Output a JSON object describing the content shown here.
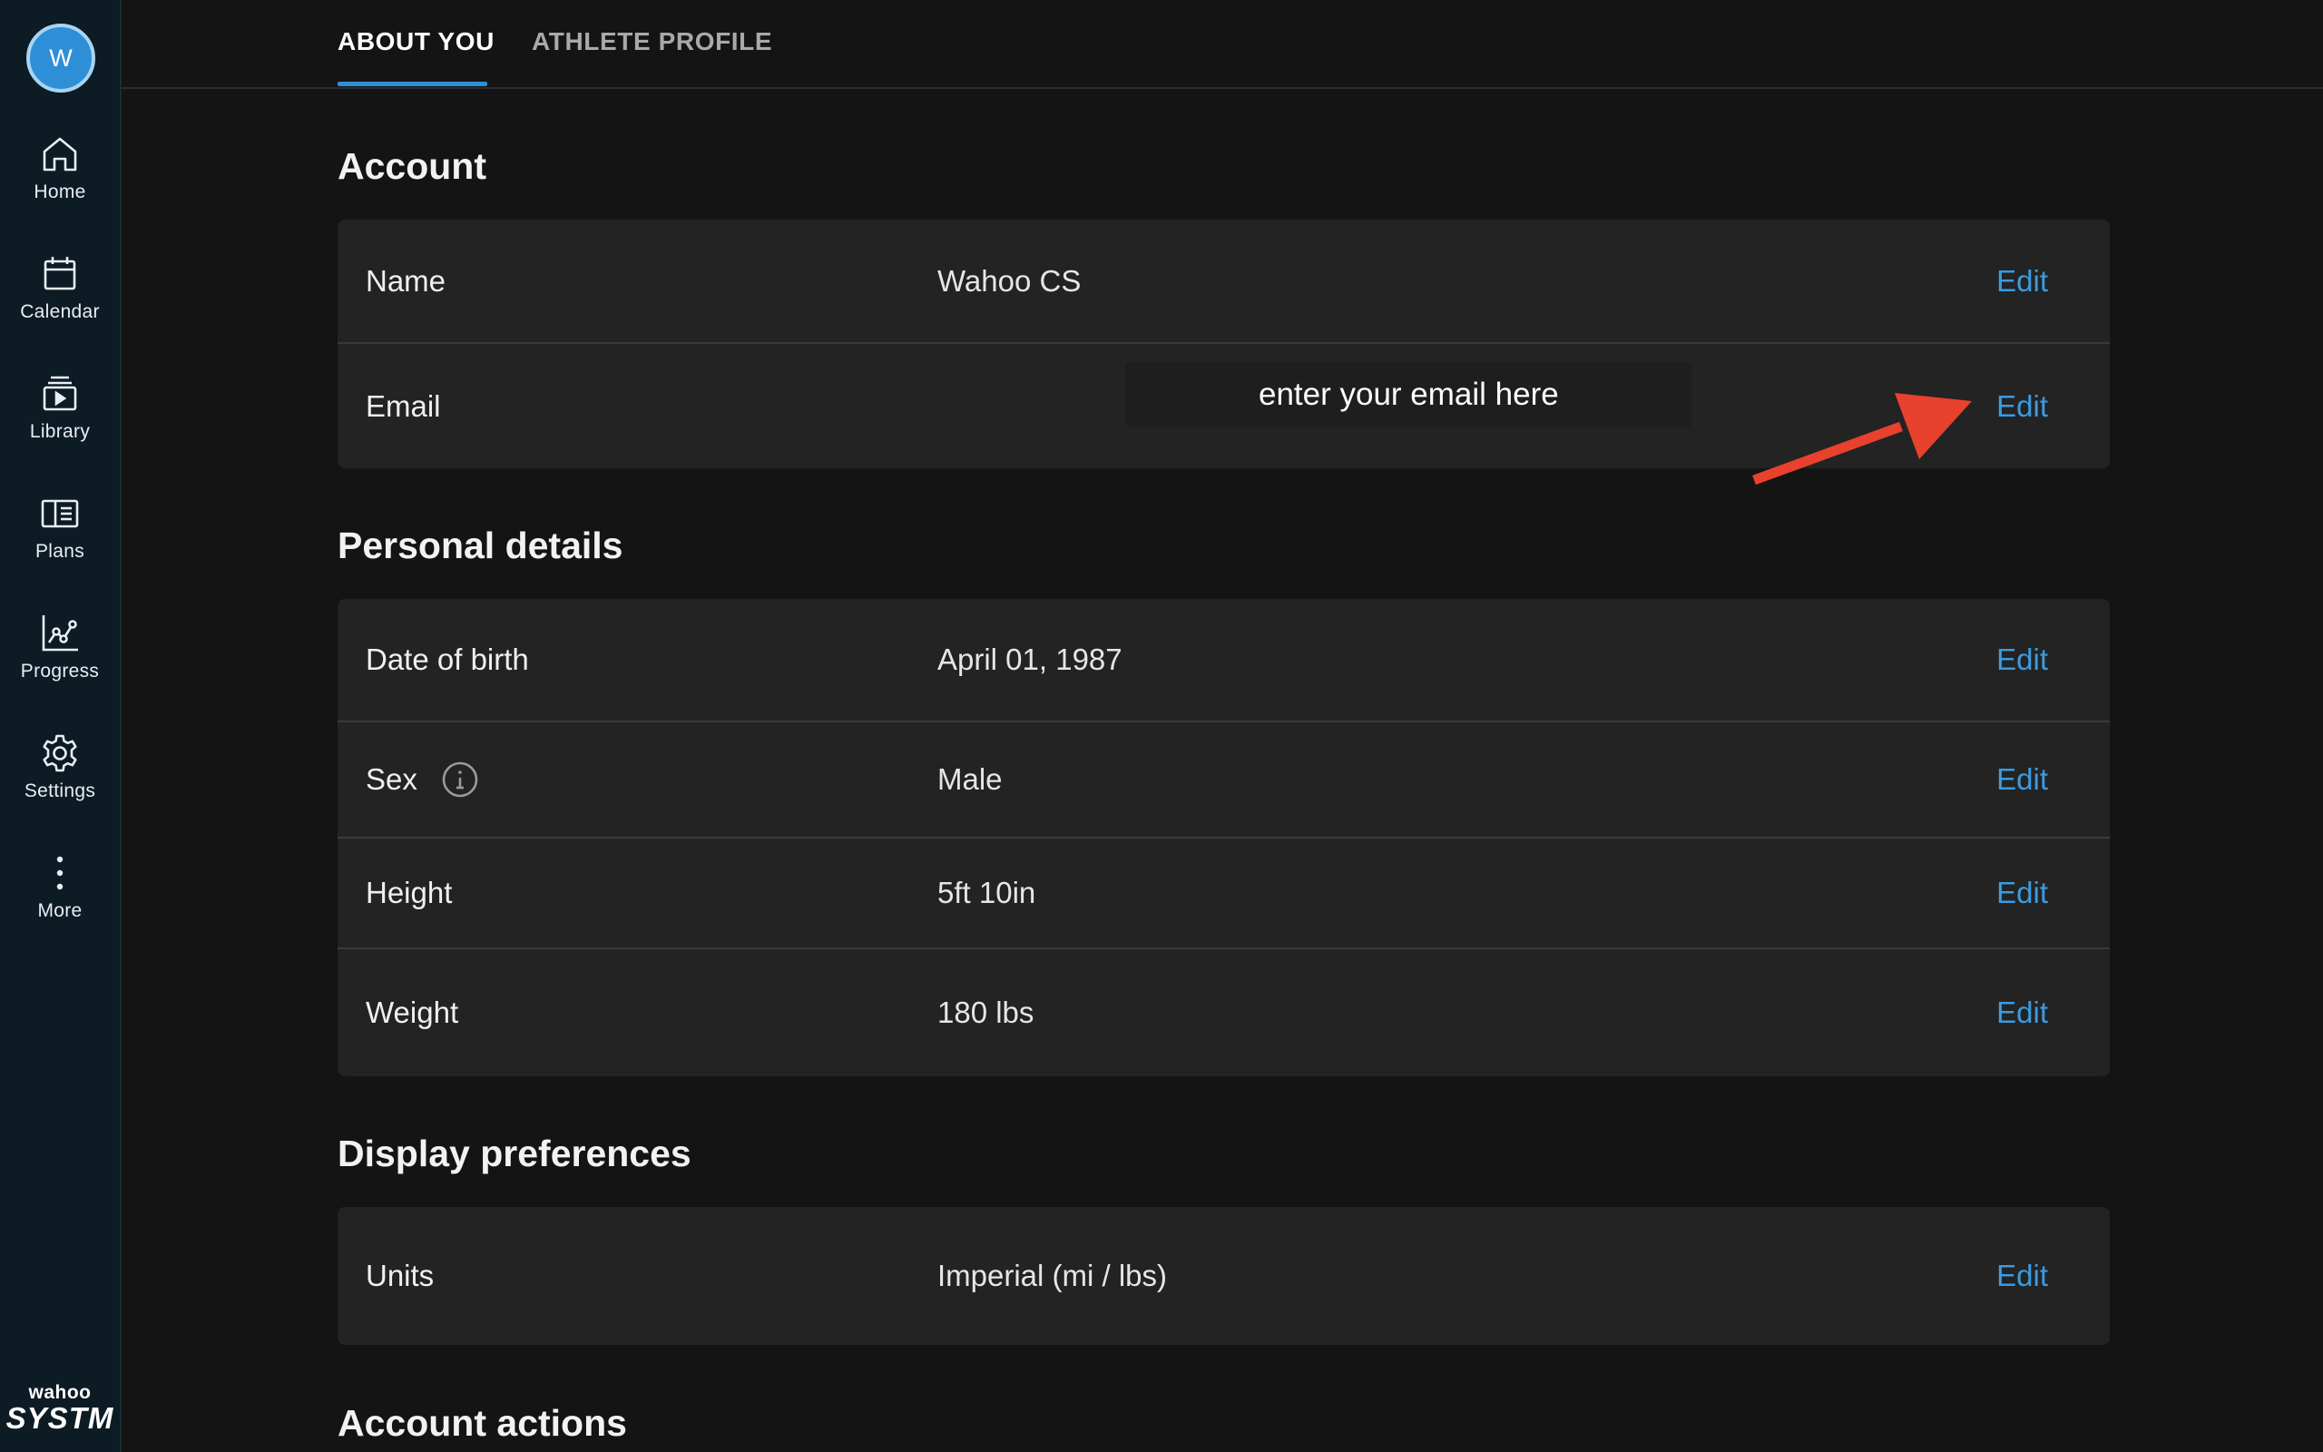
{
  "user": {
    "avatar_initial": "W"
  },
  "sidebar": {
    "items": [
      {
        "label": "Home",
        "icon": "home-icon"
      },
      {
        "label": "Calendar",
        "icon": "calendar-icon"
      },
      {
        "label": "Library",
        "icon": "library-icon"
      },
      {
        "label": "Plans",
        "icon": "plans-icon"
      },
      {
        "label": "Progress",
        "icon": "progress-icon"
      },
      {
        "label": "Settings",
        "icon": "gear-icon"
      },
      {
        "label": "More",
        "icon": "more-vertical-icon"
      }
    ],
    "brand_top": "wahoo",
    "brand_bottom": "SYSTM"
  },
  "tabs": [
    {
      "label": "ABOUT YOU",
      "active": true
    },
    {
      "label": "ATHLETE PROFILE",
      "active": false
    }
  ],
  "sections": {
    "account": {
      "title": "Account",
      "rows": [
        {
          "label": "Name",
          "value": "Wahoo CS",
          "action": "Edit"
        },
        {
          "label": "Email",
          "value": "enter your email here",
          "action": "Edit"
        }
      ]
    },
    "personal": {
      "title": "Personal details",
      "rows": [
        {
          "label": "Date of birth",
          "value": "April 01, 1987",
          "action": "Edit"
        },
        {
          "label": "Sex",
          "value": "Male",
          "action": "Edit"
        },
        {
          "label": "Height",
          "value": "5ft 10in",
          "action": "Edit"
        },
        {
          "label": "Weight",
          "value": "180 lbs",
          "action": "Edit"
        }
      ]
    },
    "display": {
      "title": "Display preferences",
      "rows": [
        {
          "label": "Units",
          "value": "Imperial (mi / lbs)",
          "action": "Edit"
        }
      ]
    },
    "actions": {
      "title": "Account actions"
    }
  },
  "colors": {
    "accent": "#2f8fd6",
    "link": "#3b9be0",
    "annotation_arrow": "#e8412e",
    "sidebar_bg": "#0d1b24",
    "page_bg": "#141414",
    "card_bg": "#232323"
  }
}
